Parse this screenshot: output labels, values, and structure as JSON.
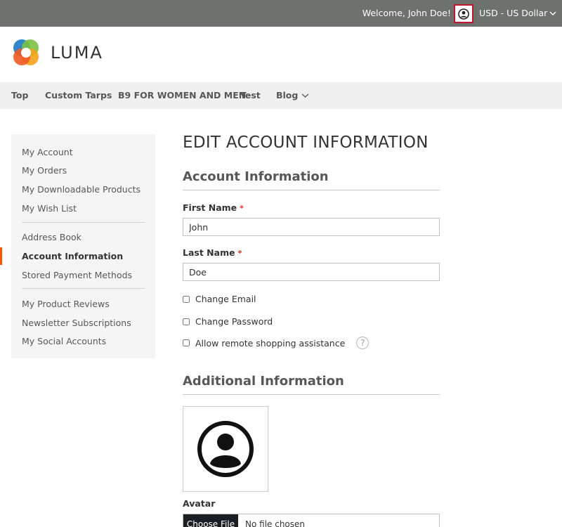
{
  "header": {
    "welcome": "Welcome, John Doe!",
    "account_icon": "user-circle-icon",
    "currency": "USD - US Dollar"
  },
  "logo": {
    "text": "LUMA"
  },
  "nav": {
    "items": [
      {
        "label": "Top"
      },
      {
        "label": "Custom Tarps"
      },
      {
        "label": "B9 FOR WOMEN AND MEN"
      },
      {
        "label": "Test"
      },
      {
        "label": "Blog"
      }
    ]
  },
  "sidebar": {
    "items": [
      {
        "label": "My Account"
      },
      {
        "label": "My Orders"
      },
      {
        "label": "My Downloadable Products"
      },
      {
        "label": "My Wish List"
      },
      {
        "label": "Address Book"
      },
      {
        "label": "Account Information"
      },
      {
        "label": "Stored Payment Methods"
      },
      {
        "label": "My Product Reviews"
      },
      {
        "label": "Newsletter Subscriptions"
      },
      {
        "label": "My Social Accounts"
      }
    ],
    "active": "Account Information"
  },
  "main": {
    "title": "EDIT ACCOUNT INFORMATION",
    "account_section": "Account Information",
    "first_name_label": "First Name",
    "first_name_value": "John",
    "last_name_label": "Last Name",
    "last_name_value": "Doe",
    "required_mark": "*",
    "change_email": "Change Email",
    "change_password": "Change Password",
    "remote_assist": "Allow remote shopping assistance",
    "help_glyph": "?",
    "additional_section": "Additional Information",
    "avatar_label": "Avatar",
    "choose_file": "Choose File",
    "no_file": "No file chosen"
  },
  "colors": {
    "topbar": "#6e716e",
    "accent": "#ff5501",
    "highlight": "#c0152f"
  }
}
